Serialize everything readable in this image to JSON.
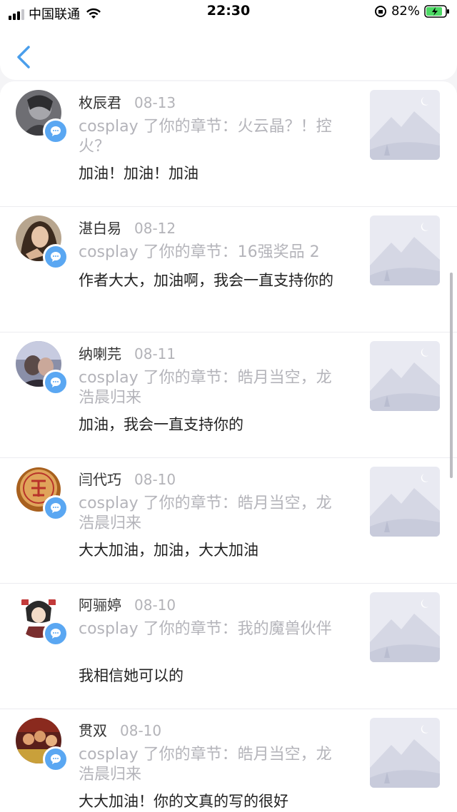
{
  "status_bar": {
    "carrier": "中国联通",
    "time": "22:30",
    "battery": "82%"
  },
  "colors": {
    "accent": "#5aa7f2",
    "name": "#333333",
    "muted": "#b4b4ba",
    "comment": "#222222"
  },
  "items": [
    {
      "name": "枚辰君",
      "date": "08-13",
      "origin": "cosplay 了你的章节：火云晶？！控火？",
      "comment": "加油！加油！加油",
      "avatar": "gray-portrait"
    },
    {
      "name": "湛白易",
      "date": "08-12",
      "origin": "cosplay 了你的章节：16强奖品 2",
      "comment": "作者大大，加油啊，我会一直支持你的",
      "avatar": "woman-photo"
    },
    {
      "name": "纳喇芫",
      "date": "08-11",
      "origin": "cosplay 了你的章节：皓月当空，龙浩晨归来",
      "comment": "加油，我会一直支持你的",
      "avatar": "couple-photo"
    },
    {
      "name": "闫代巧",
      "date": "08-10",
      "origin": "cosplay 了你的章节：皓月当空，龙浩晨归来",
      "comment": "大大加油，加油，大大加油",
      "avatar": "chess-piece"
    },
    {
      "name": "阿骊婷",
      "date": "08-10",
      "origin": "cosplay 了你的章节：我的魔兽伙伴",
      "comment": "我相信她可以的",
      "avatar": "anime-girl"
    },
    {
      "name": "贯双",
      "date": "08-10",
      "origin": "cosplay 了你的章节：皓月当空，龙浩晨归来",
      "comment": "大大加油！你的文真的写的很好",
      "avatar": "group-photo"
    }
  ]
}
